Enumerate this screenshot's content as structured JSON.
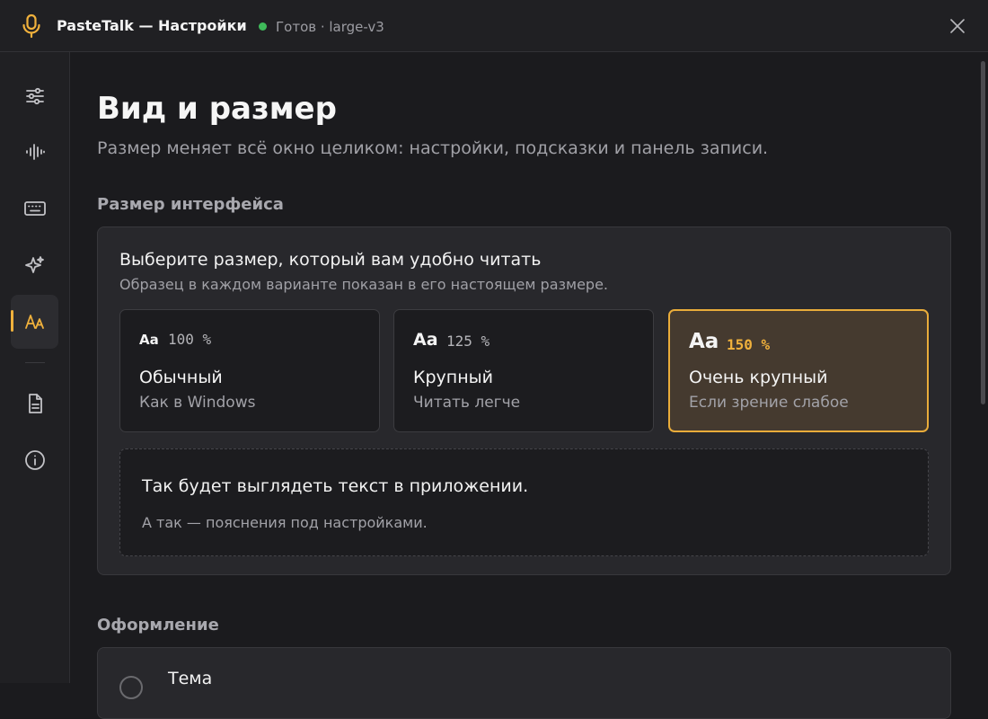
{
  "window": {
    "title": "PasteTalk — Настройки",
    "status": "Готов · large-v3",
    "status_color": "#3fba5a",
    "accent": "#f0b13c"
  },
  "sidebar": {
    "items": [
      {
        "icon": "sliders-icon"
      },
      {
        "icon": "waveform-icon"
      },
      {
        "icon": "keyboard-icon"
      },
      {
        "icon": "sparkle-icon"
      },
      {
        "icon": "text-size-icon",
        "active": true
      },
      {
        "icon": "document-icon"
      },
      {
        "icon": "info-icon"
      }
    ]
  },
  "page": {
    "title": "Вид и размер",
    "subtitle": "Размер меняет всё окно целиком: настройки, подсказки и панель записи."
  },
  "size_section": {
    "title": "Размер интерфейса",
    "card_title": "Выберите размер, который вам удобно читать",
    "card_desc": "Образец в каждом варианте показан в его настоящем размере.",
    "options": [
      {
        "sample": "Aa",
        "percent": "100 %",
        "name": "Обычный",
        "hint": "Как в Windows",
        "selected": false
      },
      {
        "sample": "Aa",
        "percent": "125 %",
        "name": "Крупный",
        "hint": "Читать легче",
        "selected": false
      },
      {
        "sample": "Aa",
        "percent": "150 %",
        "name": "Очень крупный",
        "hint": "Если зрение слабое",
        "selected": true
      }
    ],
    "preview_main": "Так будет выглядеть текст в приложении.",
    "preview_sub": "А так — пояснения под настройками."
  },
  "appearance_section": {
    "title": "Оформление",
    "theme_label": "Тема"
  }
}
